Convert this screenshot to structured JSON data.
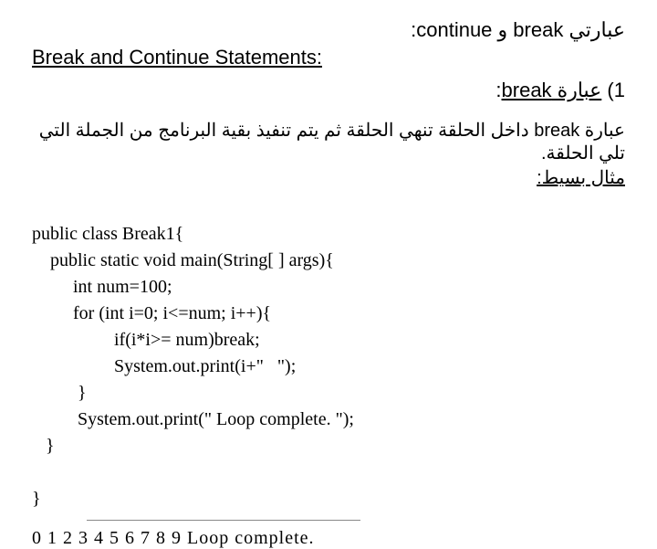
{
  "title_right": "عبارتي break و continue:",
  "title_left": "Break and Continue Statements:",
  "item1_num": "1)",
  "item1_label": "عبارة break",
  "item1_colon": ":",
  "desc": "عبارة break داخل الحلقة تنهي الحلقة ثم يتم تنفيذ بقية البرنامج من الجملة التي تلي الحلقة.",
  "example_label": "مثال بسيط:",
  "code": {
    "l1": "public class Break1{",
    "l2": "    public static void main(String[ ] args){",
    "l3": "         int num=100;",
    "l4": "         for (int i=0; i<=num; i++){",
    "l5": "                  if(i*i>= num)break;",
    "l6": "                  System.out.print(i+\"   \");",
    "l7": "          }",
    "l8": "          System.out.print(\" Loop complete. \");",
    "l9": "   }",
    "l10": "}"
  },
  "output": "0  1  2  3  4  5  6  7  8  9   Loop complete."
}
